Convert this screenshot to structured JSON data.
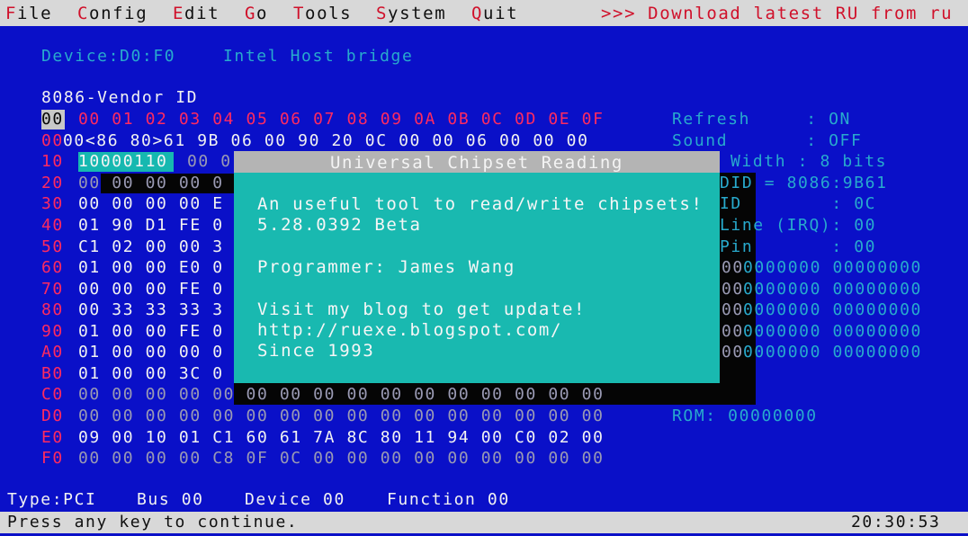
{
  "menu": {
    "items": [
      {
        "hot": "F",
        "rest": "ile"
      },
      {
        "hot": "C",
        "rest": "onfig"
      },
      {
        "hot": "E",
        "rest": "dit"
      },
      {
        "hot": "G",
        "rest": "o"
      },
      {
        "hot": "T",
        "rest": "ools"
      },
      {
        "hot": "S",
        "rest": "ystem"
      },
      {
        "hot": "Q",
        "rest": "uit"
      }
    ],
    "promo": ">>> Download latest RU from ru"
  },
  "device": {
    "label": "Device:D0:F0",
    "name": "Intel Host bridge"
  },
  "vendor_header": "8086-Vendor ID",
  "hex": {
    "col_header": "00 01 02 03 04 05 06 07 08 09 0A 0B 0C 0D 0E 0F",
    "corner": "00",
    "row_00": "00<86 80>61 9B 06 00 90 20 0C 00 00 06 00 00 00",
    "row_10_cursor": "10000110",
    "rows": [
      {
        "label": "10",
        "left": "00 0"
      },
      {
        "label": "20",
        "left": "00 00 00 00 0"
      },
      {
        "label": "30",
        "left": "00 00 00 00 E"
      },
      {
        "label": "40",
        "left": "01 90 D1 FE 0"
      },
      {
        "label": "50",
        "left": "C1 02 00 00 3"
      },
      {
        "label": "60",
        "left": "01 00 00 E0 0"
      },
      {
        "label": "70",
        "left": "00 00 00 FE 0"
      },
      {
        "label": "80",
        "left": "00 33 33 33 3"
      },
      {
        "label": "90",
        "left": "01 00 00 FE 0"
      },
      {
        "label": "A0",
        "left": "01 00 00 00 0"
      },
      {
        "label": "B0",
        "left": "01 00 00 3C 0"
      }
    ],
    "row_C0": "00 00 00 00 00 00 00 00 00 00 00 00 00 00 00 00",
    "row_D0": "00 00 00 00 00 00 00 00 00 00 00 00 00 00 00 00",
    "row_E0": "09 00 10 01 C1 60 61 7A 8C 80 11 94 00 C0 02 00",
    "row_F0": "00 00 00 00 C8 0F 0C 00 00 00 00 00 00 00 00 00",
    "labels_lower": [
      "C0",
      "D0",
      "E0",
      "F0"
    ]
  },
  "side": {
    "refresh": "Refresh     : ON",
    "sound": "Sound       : OFF",
    "width": "Width : 8 bits",
    "did": "DID = 8086:9B61",
    "id": "ID        : 0C",
    "line": "Line (IRQ): 00",
    "pin": "Pin       : 00",
    "bits": [
      "0000000 00000000",
      "0000000 00000000",
      "0000000 00000000",
      "0000000 00000000",
      "0000000 00000000"
    ],
    "bits_lead": "00",
    "rom": "ROM: 00000000"
  },
  "dialog": {
    "title": "Universal Chipset Reading",
    "line1": "An useful tool to read/write chipsets!",
    "line2": "5.28.0392 Beta",
    "line3": "Programmer: James Wang",
    "line4": "Visit my blog to get update!",
    "line5": "http://ruexe.blogspot.com/",
    "line6": "Since 1993"
  },
  "info_bar": {
    "type": "Type:PCI",
    "bus": "Bus 00",
    "device": "Device 00",
    "function": "Function 00"
  },
  "status": {
    "prompt": "Press any key to continue.",
    "time": "20:30:53"
  }
}
